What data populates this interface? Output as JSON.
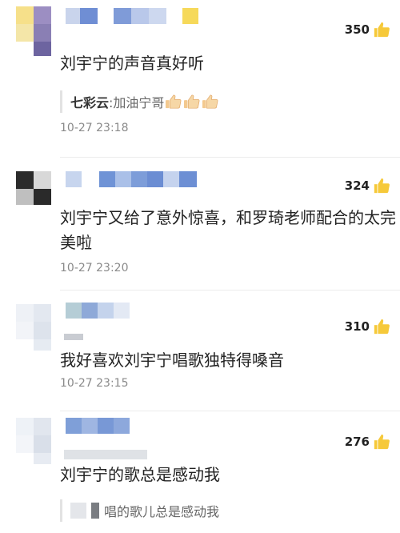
{
  "comments": [
    {
      "likes": "350",
      "text": "刘宇宁的声音真好听",
      "reply": {
        "name": "七彩云",
        "text": ":加油宁哥"
      },
      "time": "10-27 23:18"
    },
    {
      "likes": "324",
      "text": "刘宇宁又给了意外惊喜，和罗琦老师配合的太完美啦",
      "time": "10-27 23:20"
    },
    {
      "likes": "310",
      "text": "我好喜欢刘宇宁唱歌独特得嗓音",
      "time": "10-27 23:15"
    },
    {
      "likes": "276",
      "text": "刘宇宁的歌总是感动我",
      "reply": {
        "text": "唱的歌儿总是感动我"
      }
    }
  ],
  "icons": {
    "like": "thumbs-up-icon",
    "reply_emoji": "thumbs-up-emoji"
  },
  "colors": {
    "like_icon": "#f6c93a",
    "text": "#222222",
    "time": "#8a8a8a"
  }
}
